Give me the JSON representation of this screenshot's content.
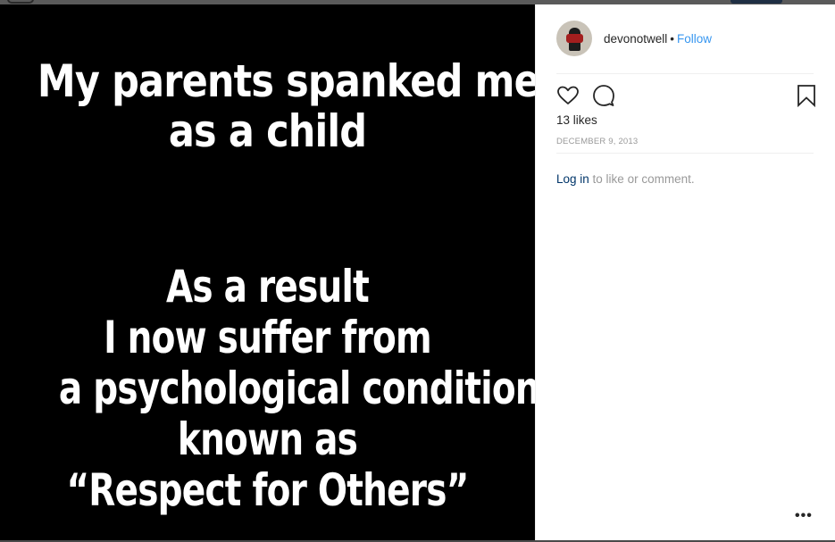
{
  "meme": {
    "top_lines": [
      "My parents spanked me",
      "as a child"
    ],
    "bottom_lines": [
      "As a result",
      "I now suffer from",
      "a psychological condition",
      "known as",
      "“Respect for Others”"
    ]
  },
  "header": {
    "username": "devonotwell",
    "separator": "•",
    "follow_label": "Follow"
  },
  "actions": {
    "icons": [
      "heart-icon",
      "comment-icon",
      "bookmark-icon"
    ]
  },
  "likes": "13 likes",
  "date": "DECEMBER 9, 2013",
  "comment_prompt": {
    "login_link": "Log in",
    "rest": " to like or comment."
  },
  "more_options": "•••",
  "colors": {
    "follow": "#3897f0",
    "login_link": "#003569",
    "muted": "#999999",
    "text": "#262626"
  }
}
